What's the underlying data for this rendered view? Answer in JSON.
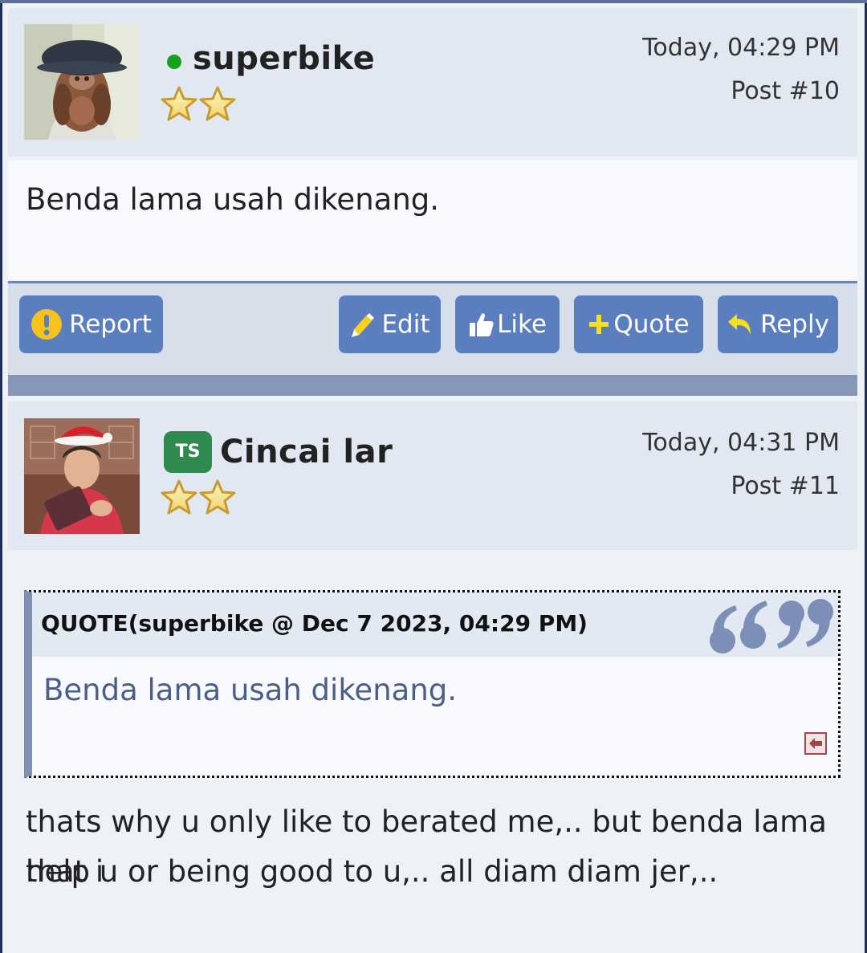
{
  "posts": [
    {
      "username": "superbike",
      "online": true,
      "rank_stars": 2,
      "date": "Today, 04:29 PM",
      "post_number": "Post #10",
      "body": "Benda lama usah dikenang."
    },
    {
      "username": "Cincai lar",
      "badge": "TS",
      "rank_stars": 2,
      "date": "Today, 04:31 PM",
      "post_number": "Post #11",
      "quote": {
        "title": "QUOTE(superbike @ Dec 7 2023, 04:29 PM)",
        "text": "Benda lama usah dikenang."
      },
      "body_line1": "thats why u only like to berated me,.. but benda lama that i",
      "body_line2": "help u or being good to u,.. all diam diam jer,.."
    }
  ],
  "actions": {
    "report": "Report",
    "edit": "Edit",
    "like": "Like",
    "quote": "Quote",
    "reply": "Reply"
  },
  "colors": {
    "button": "#5b7fbe",
    "online": "#14a21c",
    "ts_badge": "#2f8a4f",
    "quote_text": "#4b5e87"
  },
  "icons": [
    "alert-icon",
    "pencil-icon",
    "thumbs-up-icon",
    "plus-icon",
    "reply-arrow-icon",
    "star-icon",
    "quote-marks-icon",
    "back-arrow-icon"
  ]
}
